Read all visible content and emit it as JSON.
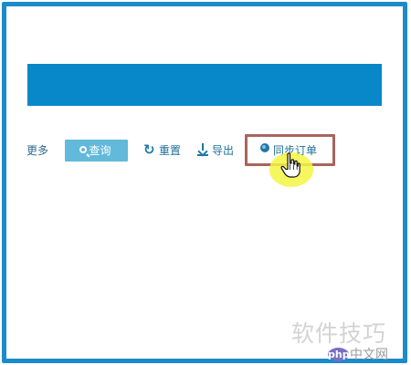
{
  "toolbar": {
    "more_label": "更多",
    "search_label": "查询",
    "reset_label": "重置",
    "export_label": "导出",
    "sync_orders_label": "同步订单"
  },
  "watermark": {
    "title": "软件技巧",
    "logo_text": "php",
    "site": "中文网"
  },
  "colors": {
    "frame": "#1b8bcb",
    "banner": "#0888c8",
    "search_button": "#62b9d9",
    "toolbar_text": "#1d6f98",
    "highlight": "#a9645c",
    "cursor_glow": "#f4f442"
  },
  "icons": {
    "search": "search-icon",
    "reset": "refresh-icon",
    "export": "download-icon",
    "sync": "globe-icon",
    "pointer": "hand-cursor-icon"
  }
}
